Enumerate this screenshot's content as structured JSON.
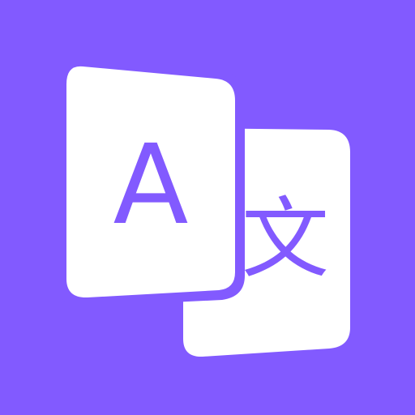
{
  "icon": {
    "name": "translate-app-icon",
    "background_color": "#825AFF",
    "card_color": "#FFFFFF",
    "latin_glyph": "A",
    "cjk_glyph": "文"
  }
}
